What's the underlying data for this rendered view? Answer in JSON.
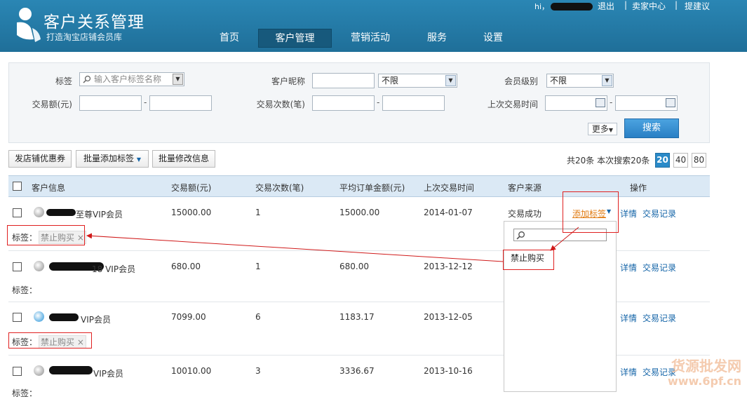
{
  "header": {
    "title": "客户关系管理",
    "subtitle": "打造淘宝店铺会员库",
    "greeting": "hi，",
    "links": [
      "退出",
      "卖家中心",
      "提建议"
    ],
    "nav": [
      "首页",
      "客户管理",
      "营销活动",
      "服务",
      "设置"
    ],
    "active_nav": "客户管理"
  },
  "filters": {
    "tag_label": "标签",
    "tag_placeholder": "输入客户标签名称",
    "nickname_label": "客户昵称",
    "nickname_option": "不限",
    "level_label": "会员级别",
    "level_option": "不限",
    "amount_label": "交易额(元)",
    "count_label": "交易次数(笔)",
    "last_time_label": "上次交易时间",
    "dash": "-",
    "more_label": "更多",
    "search_label": "搜索"
  },
  "toolbar": {
    "send_coupon": "发店铺优惠券",
    "batch_tag": "批量添加标签",
    "batch_edit": "批量修改信息",
    "count_text": "共20条 本次搜索20条",
    "page_sizes": [
      "20",
      "40",
      "80"
    ],
    "active_page_size": "20"
  },
  "table": {
    "columns": [
      "客户信息",
      "交易额(元)",
      "交易次数(笔)",
      "平均订单金额(元)",
      "上次交易时间",
      "客户来源",
      "操作"
    ],
    "rows": [
      {
        "name": "至尊VIP会员",
        "amount": "15000.00",
        "count": "1",
        "avg": "15000.00",
        "last": "2014-01-07",
        "source": "交易成功",
        "tag_label": "标签：",
        "tag": "禁止购买",
        "avatar": "gray"
      },
      {
        "name": "18 VIP会员",
        "amount": "680.00",
        "count": "1",
        "avg": "680.00",
        "last": "2013-12-12",
        "source": "",
        "tag_label": "标签：",
        "tag": "",
        "avatar": "gray"
      },
      {
        "name": "VIP会员",
        "amount": "7099.00",
        "count": "6",
        "avg": "1183.17",
        "last": "2013-12-05",
        "source": "",
        "tag_label": "标签：",
        "tag": "禁止购买",
        "avatar": "blue"
      },
      {
        "name": "VIP会员",
        "amount": "10010.00",
        "count": "3",
        "avg": "3336.67",
        "last": "2013-10-16",
        "source": "",
        "tag_label": "标签：",
        "tag": "",
        "avatar": "gray"
      }
    ],
    "actions": {
      "add_tag": "添加标签",
      "detail": "详情",
      "records": "交易记录"
    },
    "close_mark": "×"
  },
  "dropdown": {
    "item": "禁止购买"
  },
  "watermark": {
    "line1": "货源批发网",
    "line2": "www.6pf.cn"
  },
  "colors": {
    "header": "#2a86b4",
    "accent": "#2a8ac8",
    "annotation": "#e02020",
    "link": "#1565a8"
  }
}
